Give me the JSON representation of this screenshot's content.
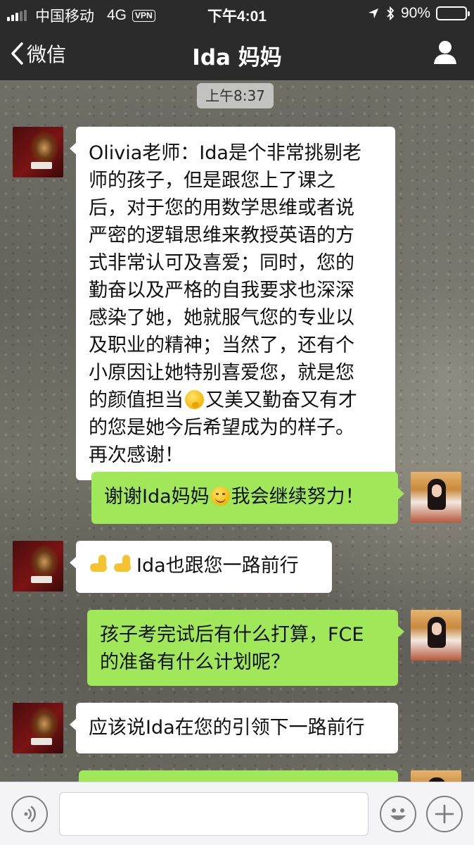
{
  "status_bar": {
    "carrier": "中国移动",
    "network": "4G",
    "vpn": "VPN",
    "time": "下午4:01",
    "battery": "90%",
    "battery_level": 0.9
  },
  "nav": {
    "back_label": "微信",
    "title": "Ida 妈妈"
  },
  "chat": {
    "timestamp": "上午8:37",
    "messages": [
      {
        "sender": "Ida妈妈",
        "lines": [
          "Olivia老师：Ida是个非常挑剔老",
          "师的孩子，但是跟您上了课之",
          "后，对于您的用数学思维或者说",
          "严密的逻辑思维来教授英语的方",
          "式非常认可及喜爱；同时，您的",
          "勤奋以及严格的自我要求也深深",
          "感染了她，她就服气您的专业以",
          "及职业的精神；当然了，还有个",
          "小原因让她特别喜爱您，就是您"
        ],
        "line10_before": "的颜值担当",
        "line10_after": "又美又勤奋又有才",
        "line11": "的您是她今后希望成为的样子。",
        "line12": "再次感谢！"
      },
      {
        "sender": "me",
        "before": "谢谢Ida妈妈",
        "after": "我会继续努力！"
      },
      {
        "sender": "Ida妈妈",
        "text": "Ida也跟您一路前行"
      },
      {
        "sender": "me",
        "line1": "孩子考完试后有什么打算，FCE",
        "line2": "的准备有什么计划呢？"
      },
      {
        "sender": "Ida妈妈",
        "text": "应该说Ida在您的引领下一路前行"
      }
    ]
  },
  "colors": {
    "header_bg": "#2b2b2b",
    "bubble_in": "#ffffff",
    "bubble_out": "#a0e75a",
    "input_bar_bg": "#f4f4f6"
  }
}
